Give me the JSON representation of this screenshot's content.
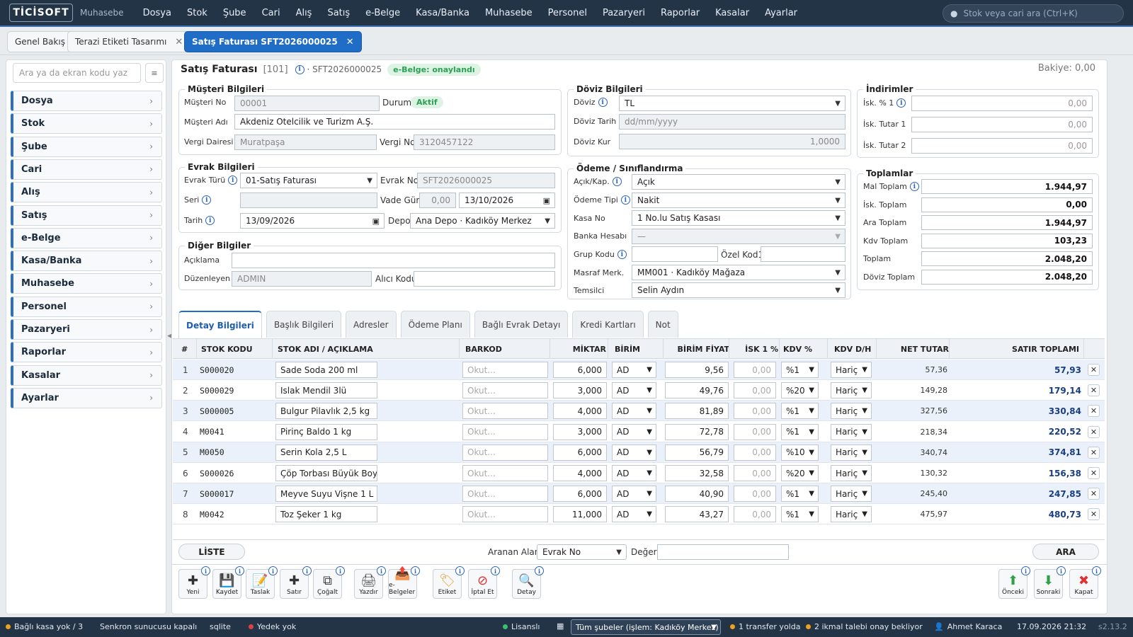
{
  "app": {
    "logo": "TİCİSOFT",
    "module": "Muhasebe"
  },
  "menu": [
    "Dosya",
    "Stok",
    "Şube",
    "Cari",
    "Alış",
    "Satış",
    "e-Belge",
    "Kasa/Banka",
    "Muhasebe",
    "Personel",
    "Pazaryeri",
    "Raporlar",
    "Kasalar",
    "Ayarlar"
  ],
  "top_search": {
    "placeholder": "Stok veya cari ara (Ctrl+K)"
  },
  "window_tabs": [
    {
      "label": "Genel Bakış"
    },
    {
      "label": "Terazi Etiketi Tasarımı"
    },
    {
      "label": "Satış Faturası SFT2026000025"
    }
  ],
  "sidebar": {
    "search_placeholder": "Ara ya da ekran kodu yaz",
    "items": [
      "Dosya",
      "Stok",
      "Şube",
      "Cari",
      "Alış",
      "Satış",
      "e-Belge",
      "Kasa/Banka",
      "Muhasebe",
      "Personel",
      "Pazaryeri",
      "Raporlar",
      "Kasalar",
      "Ayarlar"
    ]
  },
  "invoice": {
    "title": "Satış Faturası",
    "code": "[101]",
    "number": "· SFT2026000025",
    "ebelge": "e-Belge: onaylandı",
    "balance": "Bakiye: 0,00"
  },
  "musteri": {
    "legend": "Müşteri Bilgileri",
    "no_label": "Müşteri No",
    "no": "00001",
    "durum_label": "Durum",
    "durum": "Aktif",
    "adi_label": "Müşteri Adı",
    "adi": "Akdeniz Otelcilik ve Turizm A.Ş.",
    "vd_label": "Vergi Dairesi",
    "vd": "Muratpaşa",
    "vno_label": "Vergi No",
    "vno": "3120457122"
  },
  "evrak": {
    "legend": "Evrak Bilgileri",
    "tur_label": "Evrak Türü",
    "tur": "01-Satış Faturası",
    "no_label": "Evrak No",
    "no": "SFT2026000025",
    "seri_label": "Seri",
    "seri": "",
    "vade_label": "Vade Gün",
    "vade": "0,00",
    "vade_tarih": "13/10/2026",
    "tarih_label": "Tarih",
    "tarih": "13/09/2026",
    "depo_label": "Depo",
    "depo": "Ana Depo · Kadıköy Merkez"
  },
  "diger": {
    "legend": "Diğer Bilgiler",
    "aciklama_label": "Açıklama",
    "aciklama": "",
    "duzenleyen_label": "Düzenleyen",
    "duzenleyen": "ADMIN",
    "alici_label": "Alıcı Kodu",
    "alici": ""
  },
  "doviz": {
    "legend": "Döviz Bilgileri",
    "doviz_label": "Döviz",
    "doviz": "TL",
    "tarih_label": "Döviz Tarih",
    "tarih_placeholder": "dd/mm/yyyy",
    "kur_label": "Döviz Kur",
    "kur": "1,0000"
  },
  "odeme": {
    "legend": "Ödeme / Sınıflandırma",
    "acik_label": "Açık/Kap.",
    "acik": "Açık",
    "tip_label": "Ödeme Tipi",
    "tip": "Nakit",
    "kasa_label": "Kasa No",
    "kasa": "1 No.lu Satış Kasası",
    "banka_label": "Banka Hesabı",
    "banka": "—",
    "grup_label": "Grup Kodu",
    "grup": "",
    "ozel_label": "Özel Kod1",
    "ozel": "",
    "masraf_label": "Masraf Merk.",
    "masraf": "MM001 · Kadıköy Mağaza",
    "temsilci_label": "Temsilci",
    "temsilci": "Selin Aydın"
  },
  "indirimler": {
    "legend": "İndirimler",
    "rows": [
      {
        "label": "İsk. % 1",
        "value": "0,00"
      },
      {
        "label": "İsk. Tutar 1",
        "value": "0,00"
      },
      {
        "label": "İsk. Tutar 2",
        "value": "0,00"
      }
    ]
  },
  "toplamlar": {
    "legend": "Toplamlar",
    "rows": [
      {
        "label": "Mal Toplam",
        "value": "1.944,97"
      },
      {
        "label": "İsk. Toplam",
        "value": "0,00"
      },
      {
        "label": "Ara Toplam",
        "value": "1.944,97"
      },
      {
        "label": "Kdv Toplam",
        "value": "103,23"
      },
      {
        "label": "Toplam",
        "value": "2.048,20"
      },
      {
        "label": "Döviz Toplam",
        "value": "2.048,20"
      }
    ]
  },
  "detail_tabs": [
    "Detay Bilgileri",
    "Başlık Bilgileri",
    "Adresler",
    "Ödeme Planı",
    "Bağlı Evrak Detayı",
    "Kredi Kartları",
    "Not"
  ],
  "grid": {
    "headers": [
      "#",
      "STOK KODU",
      "STOK ADI / AÇIKLAMA",
      "BARKOD",
      "MİKTAR",
      "BİRİM",
      "BİRİM FİYAT",
      "İSK 1 %",
      "KDV %",
      "KDV D/H",
      "NET TUTAR",
      "SATIR TOPLAMI"
    ],
    "barcode_placeholder": "Okut...",
    "rows": [
      {
        "n": "1",
        "kod": "S000020",
        "ad": "Sade Soda 200 ml",
        "miktar": "6,000",
        "birim": "AD",
        "fiyat": "9,56",
        "isk": "0,00",
        "kdv": "%1",
        "dh": "Hariç",
        "net": "57,36",
        "toplam": "57,93"
      },
      {
        "n": "2",
        "kod": "S000029",
        "ad": "Islak Mendil 3lü",
        "miktar": "3,000",
        "birim": "AD",
        "fiyat": "49,76",
        "isk": "0,00",
        "kdv": "%20",
        "dh": "Hariç",
        "net": "149,28",
        "toplam": "179,14"
      },
      {
        "n": "3",
        "kod": "S000005",
        "ad": "Bulgur Pilavlık 2,5 kg",
        "miktar": "4,000",
        "birim": "AD",
        "fiyat": "81,89",
        "isk": "0,00",
        "kdv": "%1",
        "dh": "Hariç",
        "net": "327,56",
        "toplam": "330,84"
      },
      {
        "n": "4",
        "kod": "M0041",
        "ad": "Pirinç Baldo 1 kg",
        "miktar": "3,000",
        "birim": "AD",
        "fiyat": "72,78",
        "isk": "0,00",
        "kdv": "%1",
        "dh": "Hariç",
        "net": "218,34",
        "toplam": "220,52"
      },
      {
        "n": "5",
        "kod": "M0050",
        "ad": "Serin Kola 2,5 L",
        "miktar": "6,000",
        "birim": "AD",
        "fiyat": "56,79",
        "isk": "0,00",
        "kdv": "%10",
        "dh": "Hariç",
        "net": "340,74",
        "toplam": "374,81"
      },
      {
        "n": "6",
        "kod": "S000026",
        "ad": "Çöp Torbası Büyük Boy",
        "miktar": "4,000",
        "birim": "AD",
        "fiyat": "32,58",
        "isk": "0,00",
        "kdv": "%20",
        "dh": "Hariç",
        "net": "130,32",
        "toplam": "156,38"
      },
      {
        "n": "7",
        "kod": "S000017",
        "ad": "Meyve Suyu Vişne 1 L",
        "miktar": "6,000",
        "birim": "AD",
        "fiyat": "40,90",
        "isk": "0,00",
        "kdv": "%1",
        "dh": "Hariç",
        "net": "245,40",
        "toplam": "247,85"
      },
      {
        "n": "8",
        "kod": "M0042",
        "ad": "Toz Şeker 1 kg",
        "miktar": "11,000",
        "birim": "AD",
        "fiyat": "43,27",
        "isk": "0,00",
        "kdv": "%1",
        "dh": "Hariç",
        "net": "475,97",
        "toplam": "480,73"
      }
    ]
  },
  "search_bar": {
    "liste": "LİSTE",
    "aranan_label": "Aranan Alan",
    "aranan": "Evrak No",
    "deger_label": "Değer",
    "deger": "",
    "ara": "ARA"
  },
  "toolbar": {
    "left": [
      {
        "icon": "plus-icon",
        "glyph": "✚",
        "label": "Yeni"
      },
      {
        "icon": "save-icon",
        "glyph": "💾",
        "label": "Kaydet"
      },
      {
        "icon": "draft-icon",
        "glyph": "📝",
        "label": "Taslak"
      },
      {
        "icon": "add-row-icon",
        "glyph": "✚",
        "label": "Satır"
      },
      {
        "icon": "copy-icon",
        "glyph": "⧉",
        "label": "Çoğalt"
      },
      {
        "icon": "printer-icon",
        "glyph": "🖨",
        "label": "Yazdır"
      },
      {
        "icon": "ebelge-icon",
        "glyph": "📤",
        "label": "e-Belgeler"
      },
      {
        "icon": "label-icon",
        "glyph": "🏷",
        "label": "Etiket"
      },
      {
        "icon": "cancel-icon",
        "glyph": "⊘",
        "label": "İptal Et"
      },
      {
        "icon": "detail-icon",
        "glyph": "🔍",
        "label": "Detay"
      }
    ],
    "right": [
      {
        "icon": "arrow-up-icon",
        "glyph": "⬆",
        "label": "Önceki"
      },
      {
        "icon": "arrow-down-icon",
        "glyph": "⬇",
        "label": "Sonraki"
      },
      {
        "icon": "close-icon",
        "glyph": "✖",
        "label": "Kapat"
      }
    ]
  },
  "status": {
    "kasa": "Bağlı kasa yok / 3",
    "senkron": "Senkron sunucusu kapalı",
    "db": "sqlite",
    "yedek": "Yedek yok",
    "lisans": "Lisanslı",
    "branch": "Tüm şubeler (işlem: Kadıköy Merkez)",
    "transfer": "1 transfer yolda",
    "ikmal": "2 ikmal talebi onay bekliyor",
    "user": "Ahmet Karaca",
    "datetime": "17.09.2026 21:32",
    "version": "s2.13.2"
  },
  "colors": {
    "accent": "#1f6dc6",
    "nav": "#243447",
    "success": "#2f9e55",
    "danger": "#d33",
    "warn": "#f0a020"
  }
}
